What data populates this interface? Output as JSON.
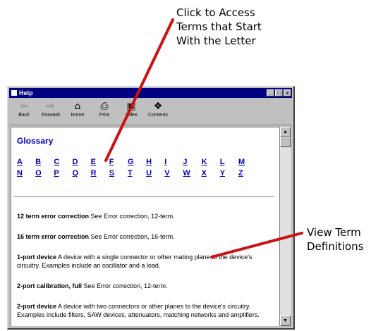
{
  "annotations": {
    "top": "Click to Access\nTerms that Start\nWith the Letter",
    "right": "View Term\nDefinitions"
  },
  "window": {
    "title": "Help",
    "controls": [
      "_",
      "□",
      "x"
    ]
  },
  "toolbar": [
    {
      "label": "Back",
      "icon": "back-arrow-icon"
    },
    {
      "label": "Forward",
      "icon": "forward-arrow-icon"
    },
    {
      "label": "Home",
      "icon": "home-icon"
    },
    {
      "label": "Print",
      "icon": "print-icon"
    },
    {
      "label": "Index",
      "icon": "index-icon"
    },
    {
      "label": "Contents",
      "icon": "contents-icon"
    }
  ],
  "content": {
    "heading": "Glossary",
    "letters_row1": [
      "A",
      "B",
      "C",
      "D",
      "E",
      "F",
      "G",
      "H",
      "I",
      "J",
      "K",
      "L",
      "M"
    ],
    "letters_row2": [
      "N",
      "O",
      "P",
      "Q",
      "R",
      "S",
      "T",
      "U",
      "V",
      "W",
      "X",
      "Y",
      "Z"
    ],
    "entries": [
      {
        "term": "12 term error correction",
        "definition": " See Error correction, 12-term."
      },
      {
        "term": "16 term error correction",
        "definition": " See Error correction, 16-term."
      },
      {
        "term": "1-port device",
        "definition": " A device with a single connector or other mating plane to the device's circuitry. Examples include an oscillator and a load."
      },
      {
        "term": "2-port calibration, full",
        "definition": " See Error correction, 12-term."
      },
      {
        "term": "2-port device",
        "definition": " A device with two connectors or other planes to the device's circuitry. Examples include filters, SAW devices, attenuators, matching networks and amplifiers."
      }
    ]
  },
  "colors": {
    "link": "#0000c0",
    "titlebar": "#000080",
    "arrow": "#cc1111"
  }
}
